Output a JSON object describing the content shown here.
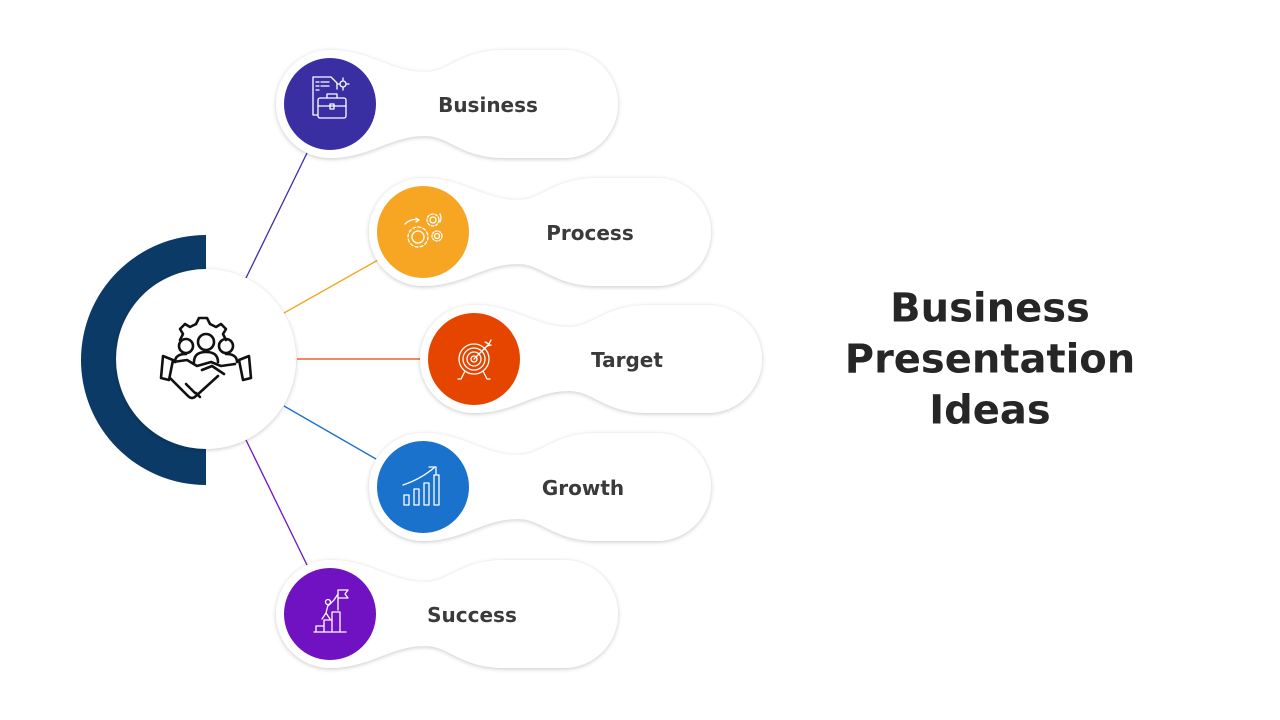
{
  "title": {
    "lines": [
      "Business",
      "Presentation",
      "Ideas"
    ]
  },
  "center": {
    "icon": "handshake-team-gear-icon",
    "ring_color": "#0b3a66"
  },
  "items": [
    {
      "label": "Business",
      "icon": "briefcase-document-icon",
      "color": "#3a2ea3"
    },
    {
      "label": "Process",
      "icon": "gears-icon",
      "color": "#f6a623"
    },
    {
      "label": "Target",
      "icon": "target-arrow-icon",
      "color": "#e64500"
    },
    {
      "label": "Growth",
      "icon": "growth-chart-icon",
      "color": "#1b72cc"
    },
    {
      "label": "Success",
      "icon": "climber-flag-icon",
      "color": "#7012c2"
    }
  ]
}
